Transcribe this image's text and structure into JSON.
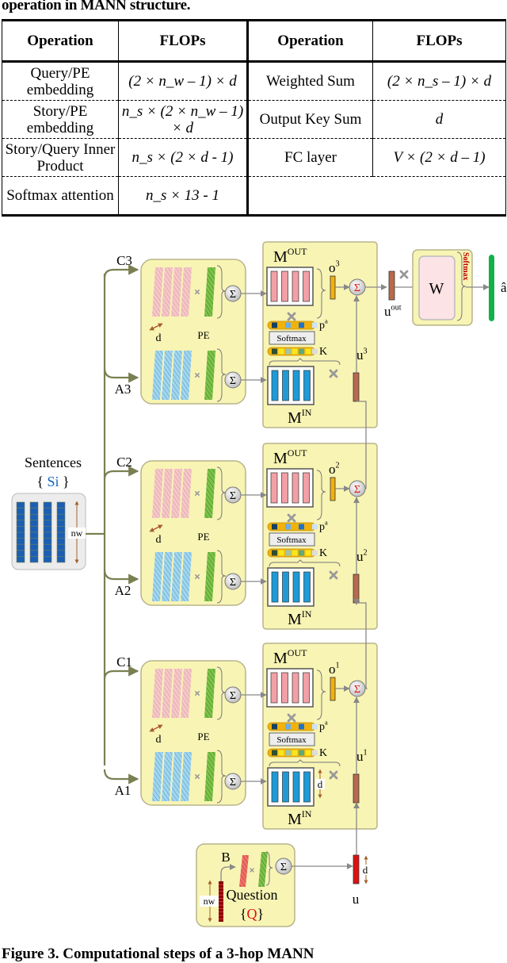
{
  "table_caption": "operation in MANN structure.",
  "table": {
    "headers": [
      "Operation",
      "FLOPs",
      "Operation",
      "FLOPs"
    ],
    "rows": [
      {
        "op1": "Query/PE embedding",
        "f1": "(2 × n_w – 1) × d",
        "op2": "Weighted Sum",
        "f2": "(2 × n_s – 1) × d"
      },
      {
        "op1": "Story/PE embedding",
        "f1": "n_s × (2 × n_w – 1) × d",
        "op2": "Output Key Sum",
        "f2": "d"
      },
      {
        "op1": "Story/Query Inner Product",
        "f1": "n_s × (2 × d - 1)",
        "op2": "FC layer",
        "f2": "V × (2 × d – 1)"
      },
      {
        "op1": "Softmax attention",
        "f1": "n_s × 13 - 1",
        "op2": "",
        "f2": ""
      }
    ]
  },
  "figure": {
    "sentences_label": "Sentences",
    "sentences_set": "Si",
    "nw_label": "nw",
    "d_label": "d",
    "pe_label": "PE",
    "softmax_label": "Softmax",
    "k_label": "K",
    "pa_label": "p",
    "pa_sup": "a",
    "mout_label": "M",
    "mout_sup": "OUT",
    "min_label": "M",
    "min_sup": "IN",
    "w_label": "W",
    "final_softmax_label": "Softmax",
    "answer_label": "â",
    "uout_label": "u",
    "uout_sup": "out",
    "u_label": "u",
    "question_label": "Question",
    "question_set": "Q",
    "b_label": "B",
    "hops": [
      {
        "c": "C3",
        "a": "A3",
        "o": "o",
        "o_sup": "3",
        "u": "u",
        "u_sup": "3"
      },
      {
        "c": "C2",
        "a": "A2",
        "o": "o",
        "o_sup": "2",
        "u": "u",
        "u_sup": "2"
      },
      {
        "c": "C1",
        "a": "A1",
        "o": "o",
        "o_sup": "1",
        "u": "u",
        "u_sup": "1"
      }
    ],
    "colors": {
      "panel": "#f8f4b4",
      "panel_border": "#b8b48a",
      "line": "#7a7f52",
      "arrow": "#888888",
      "pink": "#f2a0a6",
      "blue": "#1e9ad6",
      "green": "#74c043",
      "orange": "#f3b10e",
      "brown": "#b96a4c",
      "red": "#e01010",
      "answer_green": "#12b04a",
      "sentence_blue": "#1565c0"
    }
  },
  "figure_caption": "Figure 3. Computational steps of a 3-hop MANN"
}
